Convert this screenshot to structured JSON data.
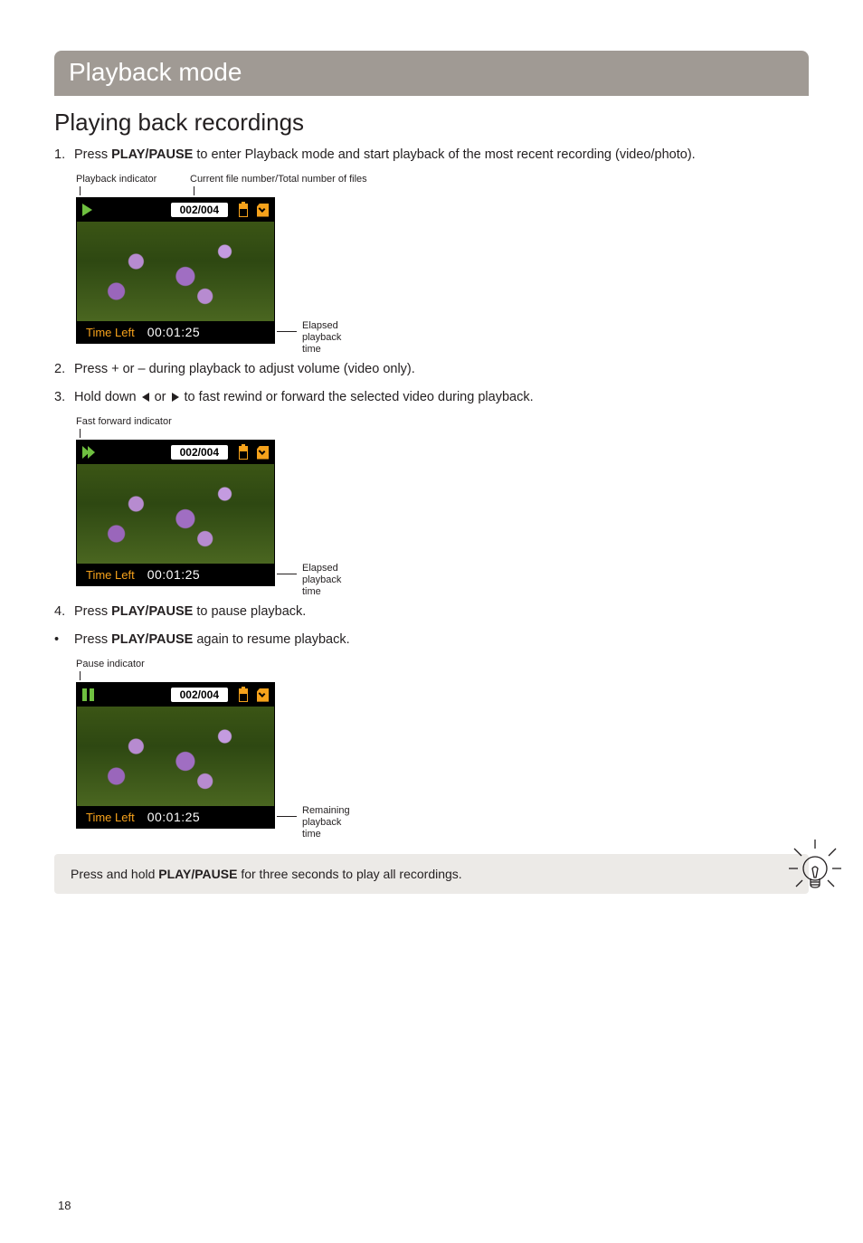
{
  "page_number": "18",
  "banner": "Playback mode",
  "heading": "Playing back recordings",
  "step1": {
    "num": "1.",
    "pre": "Press ",
    "bold": "PLAY/PAUSE",
    "post": " to enter Playback mode and start playback of the most recent recording (video/photo)."
  },
  "anno": {
    "playback_indicator": "Playback indicator",
    "file_count": "Current file number/Total number of files",
    "elapsed": "Elapsed playback time",
    "ff_indicator": "Fast forward indicator",
    "pause_indicator": "Pause indicator",
    "remaining": "Remaining playback time"
  },
  "lcd": {
    "file_counter": "002/004",
    "time_left_label": "Time Left",
    "time": "00:01:25"
  },
  "step2": {
    "num": "2.",
    "text": "Press + or – during playback to adjust volume (video only)."
  },
  "step3": {
    "num": "3.",
    "pre": "Hold down ",
    "mid": " or ",
    "post": " to fast rewind or forward the selected video during playback."
  },
  "step4": {
    "num": "4.",
    "pre": "Press ",
    "bold": "PLAY/PAUSE",
    "post": " to pause playback."
  },
  "step4b": {
    "dot": "•",
    "pre": "Press ",
    "bold": "PLAY/PAUSE",
    "post": " again to resume playback."
  },
  "tip": {
    "pre": "Press and hold ",
    "bold": "PLAY/PAUSE",
    "post": " for three seconds to play all recordings."
  }
}
